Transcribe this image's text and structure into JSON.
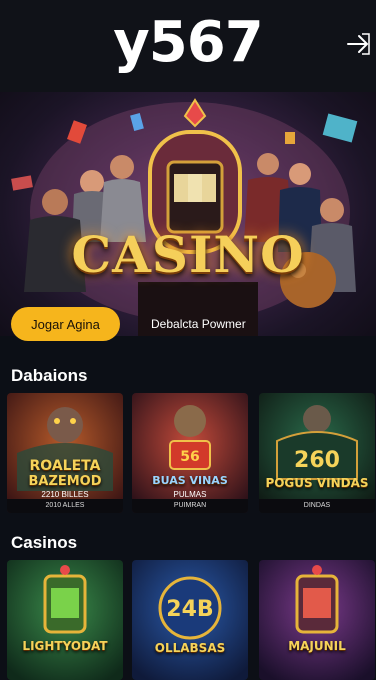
{
  "header": {
    "logo": "y567",
    "login_icon": "login-arrow-icon"
  },
  "hero": {
    "title": "CASINO",
    "primary_button": "Jogar Agina",
    "secondary_button": "Debalcta Powmer"
  },
  "sections": [
    {
      "title": "Dabaions",
      "cards": [
        {
          "title_line1": "ROALETA",
          "title_line2": "BAZEMOD",
          "subtitle": "2210 BILLES",
          "footer": "2010 ALLES"
        },
        {
          "title_line1": "BUAS VINAS",
          "title_line2": "",
          "subtitle": "PULMAS",
          "footer": "PUIMRAN"
        },
        {
          "title_line1": "POGUS VINDAS",
          "title_line2": "",
          "subtitle": "",
          "footer": "DINDAS"
        }
      ]
    },
    {
      "title": "Casinos",
      "cards": [
        {
          "title_line1": "LIGHTYODAT",
          "title_line2": "",
          "subtitle": "",
          "footer": ""
        },
        {
          "title_line1": "OLLABSAS",
          "title_line2": "",
          "subtitle": "",
          "footer": ""
        },
        {
          "title_line1": "MAJUNIL",
          "title_line2": "",
          "subtitle": "",
          "footer": ""
        }
      ]
    }
  ],
  "colors": {
    "accent": "#f6b51c",
    "background": "#0c0f16",
    "header": "#101218"
  }
}
